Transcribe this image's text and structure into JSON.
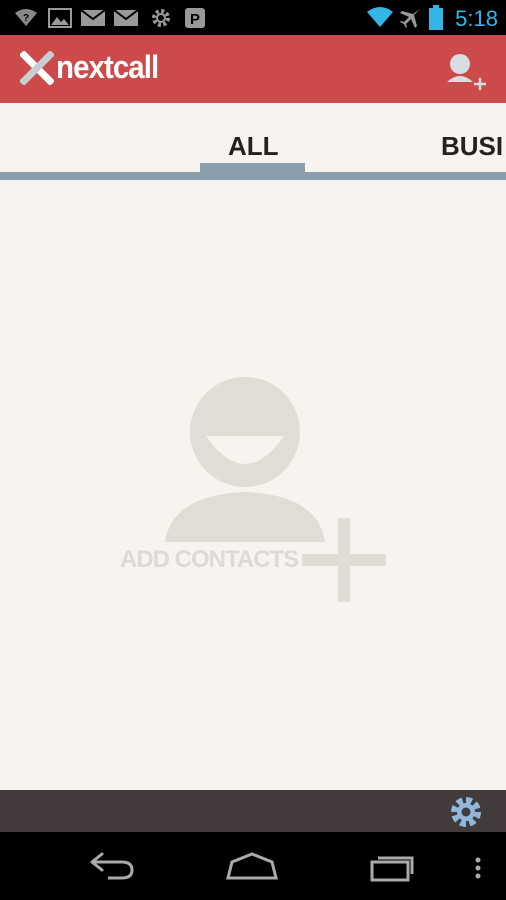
{
  "status_bar": {
    "time": "5:18",
    "icons": [
      "wifi-question-icon",
      "image-icon",
      "gmail-icon",
      "gmail-icon",
      "settings-icon",
      "parking-icon",
      "wifi-icon",
      "airplane-icon",
      "battery-icon"
    ]
  },
  "app_bar": {
    "logo_text": "nextcall",
    "action_icon": "add-contact-icon"
  },
  "tabs": [
    {
      "label": "ALL",
      "selected": true
    },
    {
      "label": "BUSI",
      "selected": false
    }
  ],
  "empty_state": {
    "label": "ADD CONTACTS",
    "icon": "add-contact-placeholder-icon"
  },
  "bottom_bar": {
    "action_icon": "gear-icon"
  },
  "nav_bar": {
    "buttons": [
      "back-icon",
      "home-icon",
      "recents-icon",
      "overflow-menu-icon"
    ]
  },
  "colors": {
    "accent": "#cc4a4a",
    "tab_indicator": "#8a9ead",
    "background": "#f7f3ef",
    "bottom_bar": "#433b3b",
    "clock": "#33b5e5"
  }
}
